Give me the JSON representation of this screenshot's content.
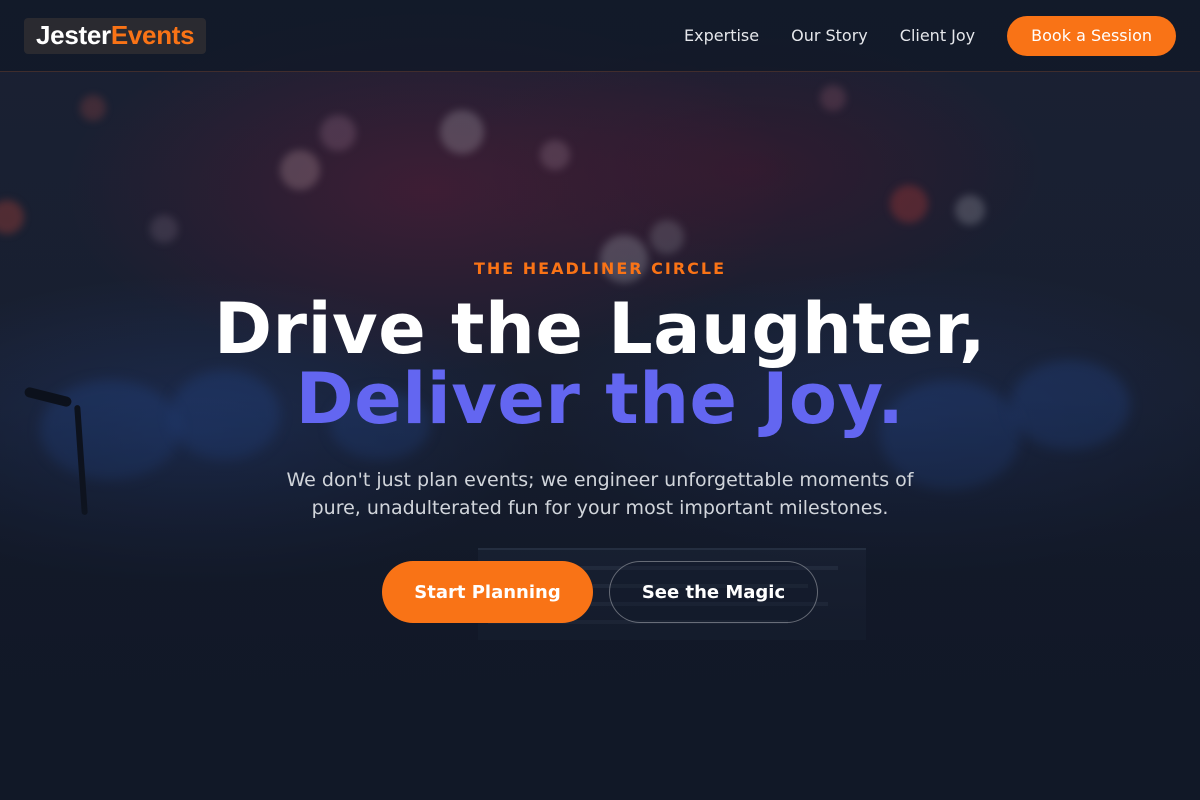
{
  "brand": {
    "name_part1": "Jester",
    "name_part2": "Events",
    "accent_color": "#f97316"
  },
  "nav": {
    "links": [
      "Expertise",
      "Our Story",
      "Client Joy"
    ],
    "cta": "Book a Session"
  },
  "hero": {
    "eyebrow": "THE HEADLINER CIRCLE",
    "headline_line1": "Drive the Laughter,",
    "headline_line2": "Deliver the Joy.",
    "subtitle": "We don't just plan events; we engineer unforgettable moments of pure, unadulterated fun for your most important milestones.",
    "primary_button": "Start Planning",
    "secondary_button": "See the Magic",
    "headline_accent_color": "#6366f1"
  }
}
